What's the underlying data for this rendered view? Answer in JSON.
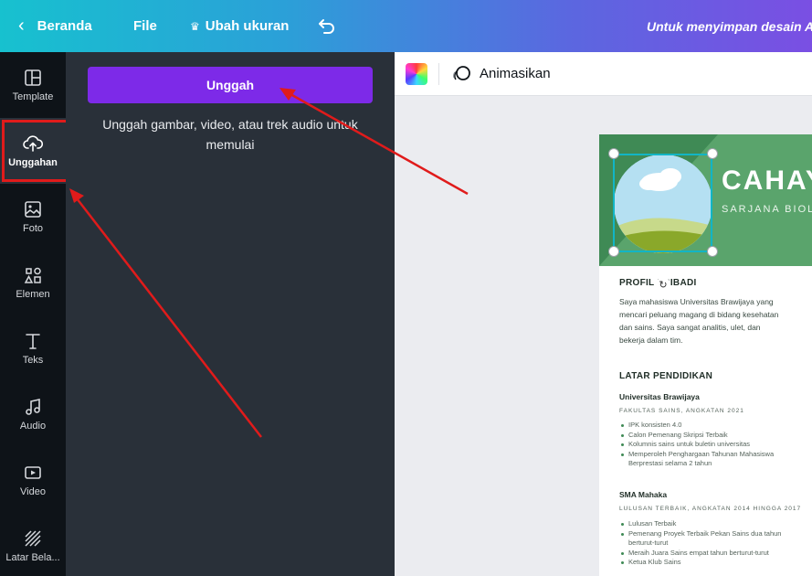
{
  "topbar": {
    "back_label": "Beranda",
    "file_label": "File",
    "resize_label": "Ubah ukuran",
    "save_notice": "Untuk menyimpan desain A"
  },
  "leftnav": {
    "items": [
      {
        "label": "Template",
        "icon": "template-icon"
      },
      {
        "label": "Unggahan",
        "icon": "cloud-upload-icon",
        "active": true
      },
      {
        "label": "Foto",
        "icon": "image-icon"
      },
      {
        "label": "Elemen",
        "icon": "shapes-icon"
      },
      {
        "label": "Teks",
        "icon": "text-icon"
      },
      {
        "label": "Audio",
        "icon": "music-note-icon"
      },
      {
        "label": "Video",
        "icon": "video-icon"
      },
      {
        "label": "Latar Bela...",
        "icon": "background-pattern-icon"
      }
    ]
  },
  "panel": {
    "upload_button": "Unggah",
    "hint": "Unggah gambar, video, atau trek audio untuk memulai"
  },
  "toolbar": {
    "animate_label": "Animasikan"
  },
  "colors": {
    "accent_purple": "#7d2ae8",
    "panel_bg": "#293039",
    "nav_bg": "#0e1318",
    "resume_green": "#5aa46c",
    "annotation_red": "#e01b1b"
  },
  "resume": {
    "name": "CAHAY",
    "subtitle": "SARJANA BIOLO",
    "profile": {
      "title": "PROFIL PRIBADI",
      "text": "Saya mahasiswa Universitas Brawijaya yang mencari peluang magang di bidang kesehatan dan sains. Saya sangat analitis, ulet, dan bekerja dalam tim."
    },
    "education": {
      "title": "LATAR PENDIDIKAN",
      "schools": [
        {
          "name": "Universitas Brawijaya",
          "meta": "FAKULTAS SAINS, ANGKATAN 2021",
          "bullets": [
            "IPK konsisten 4.0",
            "Calon Pemenang Skripsi Terbaik",
            "Kolumnis sains untuk buletin universitas",
            "Memperoleh Penghargaan Tahunan Mahasiswa Berprestasi selama 2 tahun"
          ]
        },
        {
          "name": "SMA Mahaka",
          "meta": "LULUSAN TERBAIK, ANGKATAN 2014 HINGGA 2017",
          "bullets": [
            "Lulusan Terbaik",
            "Pemenang Proyek Terbaik Pekan Sains dua tahun berturut-turut",
            "Meraih Juara Sains empat tahun berturut-turut",
            "Ketua Klub Sains"
          ]
        }
      ]
    }
  }
}
